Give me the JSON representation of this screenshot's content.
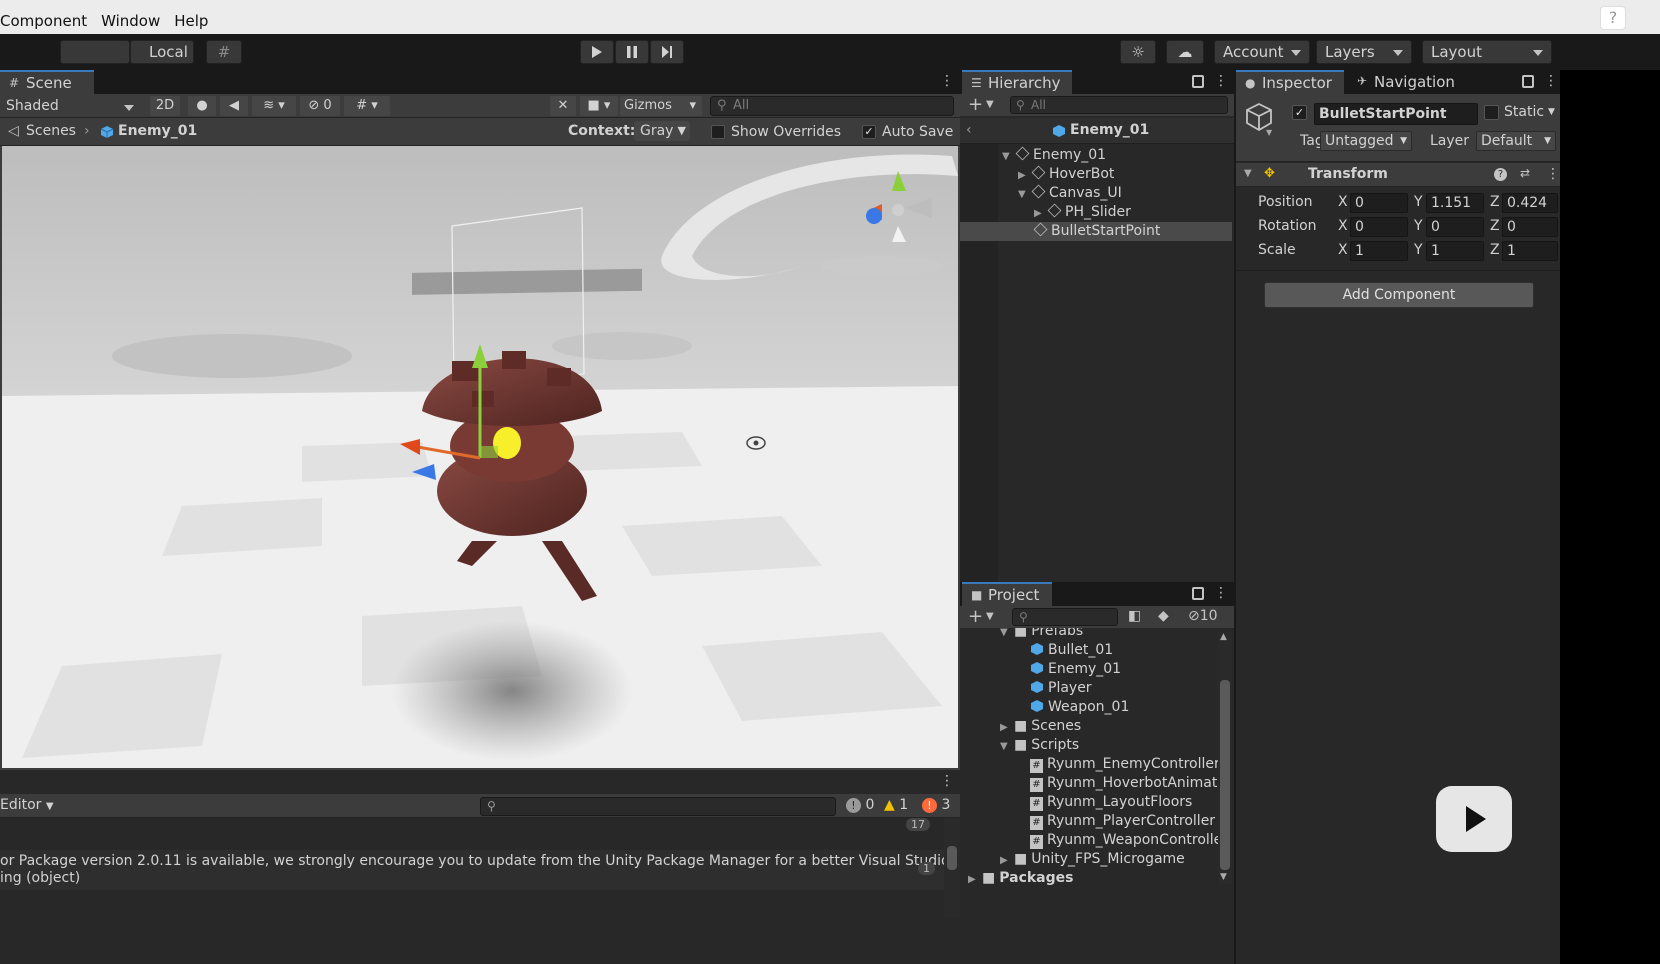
{
  "menu": {
    "items": [
      "Component",
      "Window",
      "Help"
    ],
    "help_glyph": "?"
  },
  "toolbar": {
    "local_label": "Local",
    "account_label": "Account",
    "layers_label": "Layers",
    "layout_label": "Layout"
  },
  "scene": {
    "tab_label": "Scene",
    "shading": "Shaded",
    "mode_2d": "2D",
    "hidden_count": "0",
    "gizmos_label": "Gizmos",
    "search_placeholder": "All",
    "breadcrumb_root": "Scenes",
    "breadcrumb_current": "Enemy_01",
    "context_label": "Context:",
    "context_value": "Gray",
    "show_overrides_label": "Show Overrides",
    "auto_save_label": "Auto Save"
  },
  "console": {
    "editor_label": "Editor",
    "info_count": "0",
    "warn_count": "1",
    "error_count": "3",
    "collapsed_count_a": "17",
    "collapsed_count_b": "1",
    "line1": "or Package version 2.0.11 is available, we strongly encourage you to update from the Unity Package Manager for a better Visual Studio inte",
    "line2": "ing (object)"
  },
  "hierarchy": {
    "tab_label": "Hierarchy",
    "search_placeholder": "All",
    "prefab_title": "Enemy_01",
    "rows": [
      "Enemy_01",
      "HoverBot",
      "Canvas_UI",
      "PH_Slider",
      "BulletStartPoint"
    ]
  },
  "project": {
    "tab_label": "Project",
    "hidden_count": "10",
    "rows": [
      "Prefabs",
      "Bullet_01",
      "Enemy_01",
      "Player",
      "Weapon_01",
      "Scenes",
      "Scripts",
      "Ryunm_EnemyController",
      "Ryunm_HoverbotAnimat",
      "Ryunm_LayoutFloors",
      "Ryunm_PlayerController",
      "Ryunm_WeaponControlle",
      "Unity_FPS_Microgame",
      "Packages"
    ]
  },
  "inspector": {
    "tab_label": "Inspector",
    "nav_tab_label": "Navigation",
    "object_name": "BulletStartPoint",
    "static_label": "Static",
    "tag_label": "Tag",
    "tag_value": "Untagged",
    "layer_label": "Layer",
    "layer_value": "Default",
    "transform_title": "Transform",
    "position_label": "Position",
    "rotation_label": "Rotation",
    "scale_label": "Scale",
    "axis_x": "X",
    "axis_y": "Y",
    "axis_z": "Z",
    "position": {
      "x": "0",
      "y": "1.151",
      "z": "0.424"
    },
    "rotation": {
      "x": "0",
      "y": "0",
      "z": "0"
    },
    "scale": {
      "x": "1",
      "y": "1",
      "z": "1"
    },
    "add_component_label": "Add Component"
  },
  "colors": {
    "accent": "#3a79bb",
    "warning": "#f2c200",
    "error": "#ff6a3d",
    "prefab_blue": "#4fa8e8"
  }
}
